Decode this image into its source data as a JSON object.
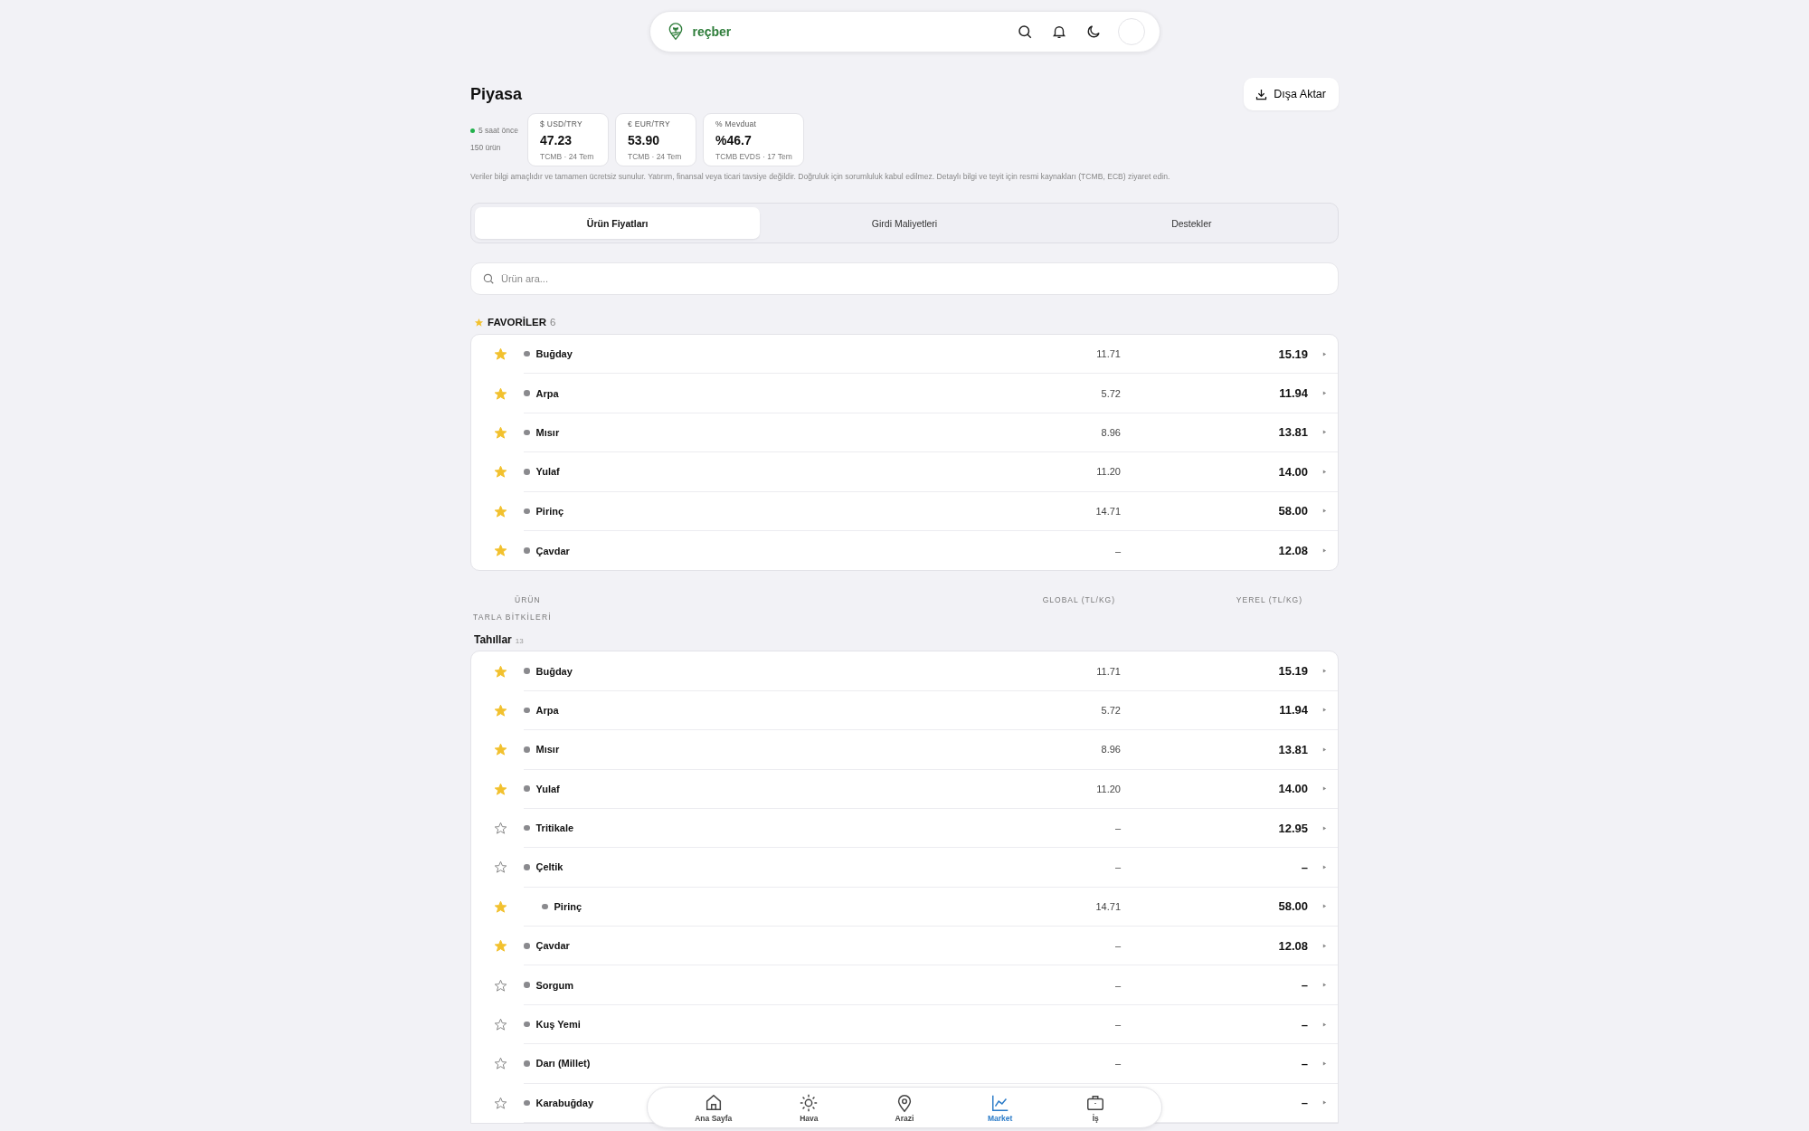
{
  "topbar": {
    "brand": "reçber"
  },
  "page": {
    "title": "Piyasa",
    "export_button": "Dışa Aktar",
    "updated": "5 saat önce",
    "product_count": "150 ürün"
  },
  "rates": [
    {
      "label": "$ USD/TRY",
      "value": "47.23",
      "source": "TCMB · 24 Tem"
    },
    {
      "label": "€ EUR/TRY",
      "value": "53.90",
      "source": "TCMB · 24 Tem"
    },
    {
      "label": "% Mevduat",
      "value": "%46.7",
      "source": "TCMB EVDS · 17 Tem"
    }
  ],
  "disclaimer": "Veriler bilgi amaçlıdır ve tamamen ücretsiz sunulur. Yatırım, finansal veya ticari tavsiye değildir. Doğruluk için sorumluluk kabul edilmez. Detaylı bilgi ve teyit için resmi kaynakları (TCMB, ECB) ziyaret edin.",
  "tabs": [
    {
      "label": "Ürün Fiyatları",
      "selected": true
    },
    {
      "label": "Girdi Maliyetleri",
      "selected": false
    },
    {
      "label": "Destekler",
      "selected": false
    }
  ],
  "search": {
    "placeholder": "Ürün ara..."
  },
  "favorites": {
    "title": "FAVORİLER",
    "count": "6",
    "rows": [
      {
        "name": "Buğday",
        "starred": true,
        "global": "11.71",
        "local": "15.19"
      },
      {
        "name": "Arpa",
        "starred": true,
        "global": "5.72",
        "local": "11.94"
      },
      {
        "name": "Mısır",
        "starred": true,
        "global": "8.96",
        "local": "13.81"
      },
      {
        "name": "Yulaf",
        "starred": true,
        "global": "11.20",
        "local": "14.00"
      },
      {
        "name": "Pirinç",
        "starred": true,
        "global": "14.71",
        "local": "58.00"
      },
      {
        "name": "Çavdar",
        "starred": true,
        "global": "–",
        "local": "12.08"
      }
    ]
  },
  "columns": [
    "ÜRÜN",
    "GLOBAL (TL/KG)",
    "YEREL (TL/KG)"
  ],
  "category": "TARLA BİTKİLERİ",
  "group": {
    "title": "Tahıllar",
    "count": "13",
    "rows": [
      {
        "name": "Buğday",
        "starred": true,
        "global": "11.71",
        "local": "15.19"
      },
      {
        "name": "Arpa",
        "starred": true,
        "global": "5.72",
        "local": "11.94"
      },
      {
        "name": "Mısır",
        "starred": true,
        "global": "8.96",
        "local": "13.81"
      },
      {
        "name": "Yulaf",
        "starred": true,
        "global": "11.20",
        "local": "14.00"
      },
      {
        "name": "Tritikale",
        "starred": false,
        "global": "–",
        "local": "12.95"
      },
      {
        "name": "Çeltik",
        "starred": false,
        "global": "–",
        "local": "–",
        "children": [
          {
            "name": "Pirinç",
            "starred": true,
            "global": "14.71",
            "local": "58.00"
          }
        ]
      },
      {
        "name": "Çavdar",
        "starred": true,
        "global": "–",
        "local": "12.08"
      },
      {
        "name": "Sorgum",
        "starred": false,
        "global": "–",
        "local": "–"
      },
      {
        "name": "Kuş Yemi",
        "starred": false,
        "global": "–",
        "local": "–"
      },
      {
        "name": "Darı (Millet)",
        "starred": false,
        "global": "–",
        "local": "–"
      },
      {
        "name": "Karabuğday",
        "starred": false,
        "local": "–"
      }
    ]
  },
  "bottom_nav": [
    {
      "label": "Ana Sayfa",
      "selected": false
    },
    {
      "label": "Hava",
      "selected": false
    },
    {
      "label": "Arazi",
      "selected": false
    },
    {
      "label": "Market",
      "selected": true
    },
    {
      "label": "İş",
      "selected": false
    }
  ]
}
